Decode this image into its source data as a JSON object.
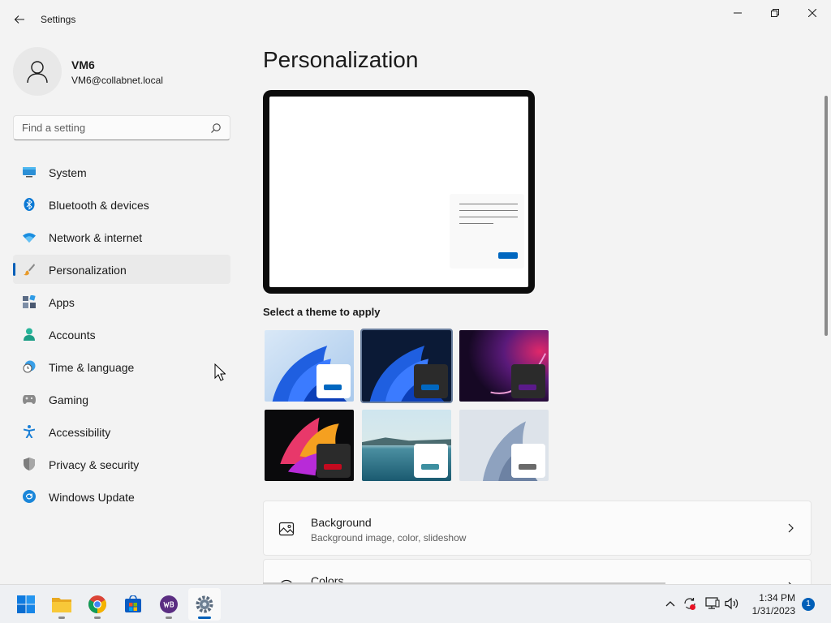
{
  "window": {
    "title": "Settings"
  },
  "user": {
    "name": "VM6",
    "email": "VM6@collabnet.local"
  },
  "search": {
    "placeholder": "Find a setting"
  },
  "sidebar": {
    "items": [
      {
        "label": "System",
        "icon": "system-icon"
      },
      {
        "label": "Bluetooth & devices",
        "icon": "bluetooth-icon"
      },
      {
        "label": "Network & internet",
        "icon": "wifi-icon"
      },
      {
        "label": "Personalization",
        "icon": "brush-icon",
        "active": true
      },
      {
        "label": "Apps",
        "icon": "apps-icon"
      },
      {
        "label": "Accounts",
        "icon": "accounts-icon"
      },
      {
        "label": "Time & language",
        "icon": "clock-globe-icon"
      },
      {
        "label": "Gaming",
        "icon": "gamepad-icon"
      },
      {
        "label": "Accessibility",
        "icon": "accessibility-icon"
      },
      {
        "label": "Privacy & security",
        "icon": "shield-icon"
      },
      {
        "label": "Windows Update",
        "icon": "update-icon"
      }
    ]
  },
  "main": {
    "title": "Personalization",
    "themes_label": "Select a theme to apply",
    "themes": [
      {
        "name": "windows-light",
        "accent": "#0067c0",
        "selected": false
      },
      {
        "name": "windows-dark",
        "accent": "#0067c0",
        "selected": true
      },
      {
        "name": "glow",
        "accent": "#5b1a8a",
        "selected": false
      },
      {
        "name": "captured-motion",
        "accent": "#c30a1f",
        "selected": false
      },
      {
        "name": "sunrise",
        "accent": "#3d8fa0",
        "selected": false
      },
      {
        "name": "flow",
        "accent": "#6a6a6a",
        "selected": false
      }
    ],
    "cards": [
      {
        "title": "Background",
        "subtitle": "Background image, color, slideshow",
        "icon": "image-icon"
      },
      {
        "title": "Colors",
        "subtitle": "",
        "icon": "palette-icon"
      }
    ]
  },
  "taskbar": {
    "apps": [
      "start-icon",
      "file-explorer-icon",
      "chrome-icon",
      "store-icon",
      "wb-app-icon",
      "settings-icon"
    ],
    "time": "1:34 PM",
    "date": "1/31/2023",
    "notifications": "1"
  },
  "colors": {
    "accent": "#005fb8"
  }
}
